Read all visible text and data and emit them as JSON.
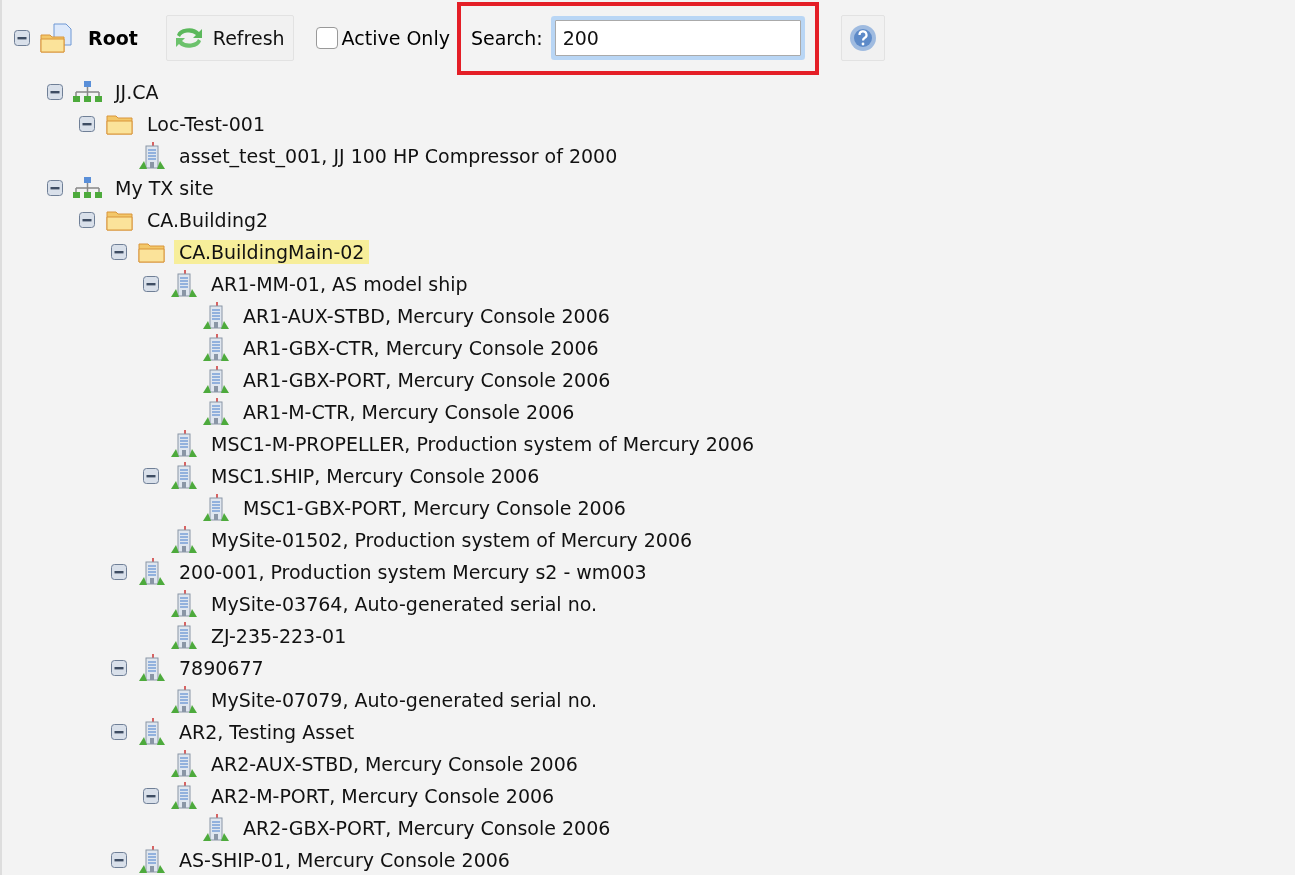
{
  "toolbar": {
    "root": {
      "label": "Root",
      "expanded": true
    },
    "refresh_button": {
      "label": "Refresh"
    },
    "active_only": {
      "label": "Active Only",
      "checked": false
    },
    "search": {
      "label": "Search:",
      "value": "200",
      "highlighted": true
    }
  },
  "tree": [
    {
      "kind": "site",
      "label": "JJ.CA",
      "selected": false,
      "expanded": true,
      "children": [
        {
          "kind": "folder",
          "label": "Loc-Test-001",
          "selected": false,
          "expanded": true,
          "children": [
            {
              "kind": "asset",
              "label": "asset_test_001, JJ 100 HP Compressor of 2000",
              "selected": false,
              "expanded": false
            }
          ]
        }
      ]
    },
    {
      "kind": "site",
      "label": "My TX site",
      "selected": false,
      "expanded": true,
      "children": [
        {
          "kind": "folder",
          "label": "CA.Building2",
          "selected": false,
          "expanded": true,
          "children": [
            {
              "kind": "folder",
              "label": "CA.BuildingMain-02",
              "selected": true,
              "expanded": true,
              "children": [
                {
                  "kind": "asset",
                  "label": "AR1-MM-01, AS model ship",
                  "selected": false,
                  "expanded": true,
                  "children": [
                    {
                      "kind": "asset",
                      "label": "AR1-AUX-STBD, Mercury Console 2006",
                      "selected": false,
                      "expanded": false
                    },
                    {
                      "kind": "asset",
                      "label": "AR1-GBX-CTR, Mercury Console 2006",
                      "selected": false,
                      "expanded": false
                    },
                    {
                      "kind": "asset",
                      "label": "AR1-GBX-PORT, Mercury Console 2006",
                      "selected": false,
                      "expanded": false
                    },
                    {
                      "kind": "asset",
                      "label": "AR1-M-CTR, Mercury Console 2006",
                      "selected": false,
                      "expanded": false
                    }
                  ]
                },
                {
                  "kind": "asset",
                  "label": "MSC1-M-PROPELLER, Production system of Mercury 2006",
                  "selected": false,
                  "expanded": false
                },
                {
                  "kind": "asset",
                  "label": "MSC1.SHIP, Mercury Console 2006",
                  "selected": false,
                  "expanded": true,
                  "children": [
                    {
                      "kind": "asset",
                      "label": "MSC1-GBX-PORT, Mercury Console 2006",
                      "selected": false,
                      "expanded": false
                    }
                  ]
                },
                {
                  "kind": "asset",
                  "label": "MySite-01502, Production system of Mercury 2006",
                  "selected": false,
                  "expanded": false
                }
              ]
            },
            {
              "kind": "asset",
              "label": "200-001, Production system Mercury s2 - wm003",
              "selected": false,
              "expanded": true,
              "children": [
                {
                  "kind": "asset",
                  "label": "MySite-03764, Auto-generated serial no.",
                  "selected": false,
                  "expanded": false
                },
                {
                  "kind": "asset",
                  "label": "ZJ-235-223-01",
                  "selected": false,
                  "expanded": false
                }
              ]
            },
            {
              "kind": "asset",
              "label": "7890677",
              "selected": false,
              "expanded": true,
              "children": [
                {
                  "kind": "asset",
                  "label": "MySite-07079, Auto-generated serial no.",
                  "selected": false,
                  "expanded": false
                }
              ]
            },
            {
              "kind": "asset",
              "label": "AR2, Testing Asset",
              "selected": false,
              "expanded": true,
              "children": [
                {
                  "kind": "asset",
                  "label": "AR2-AUX-STBD, Mercury Console 2006",
                  "selected": false,
                  "expanded": false
                },
                {
                  "kind": "asset",
                  "label": "AR2-M-PORT, Mercury Console 2006",
                  "selected": false,
                  "expanded": true,
                  "children": [
                    {
                      "kind": "asset",
                      "label": "AR2-GBX-PORT, Mercury Console 2006",
                      "selected": false,
                      "expanded": false
                    }
                  ]
                }
              ]
            },
            {
              "kind": "asset",
              "label": "AS-SHIP-01, Mercury Console 2006",
              "selected": false,
              "expanded": true
            }
          ]
        }
      ]
    }
  ]
}
